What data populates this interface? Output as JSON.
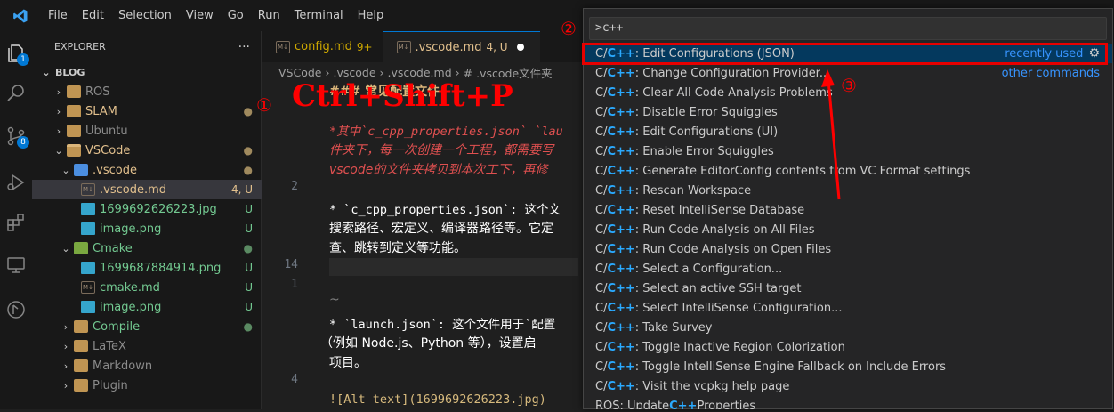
{
  "menu": [
    "File",
    "Edit",
    "Selection",
    "View",
    "Go",
    "Run",
    "Terminal",
    "Help"
  ],
  "activity_badges": {
    "explorer": "1",
    "scm": "8"
  },
  "explorer": {
    "title": "EXPLORER",
    "more": "···",
    "section": "BLOG",
    "items": [
      {
        "label": "ROS",
        "deco": ""
      },
      {
        "label": "SLAM",
        "deco": "●"
      },
      {
        "label": "Ubuntu",
        "deco": ""
      },
      {
        "label": "VSCode",
        "deco": "●"
      },
      {
        "label": ".vscode",
        "deco": "●"
      },
      {
        "label": ".vscode.md",
        "deco": "4, U"
      },
      {
        "label": "1699692626223.jpg",
        "deco": "U"
      },
      {
        "label": "image.png",
        "deco": "U"
      },
      {
        "label": "Cmake",
        "deco": "●"
      },
      {
        "label": "1699687884914.png",
        "deco": "U"
      },
      {
        "label": "cmake.md",
        "deco": "U"
      },
      {
        "label": "image.png",
        "deco": "U"
      },
      {
        "label": "Compile",
        "deco": "●"
      },
      {
        "label": "LaTeX",
        "deco": ""
      },
      {
        "label": "Markdown",
        "deco": ""
      },
      {
        "label": "Plugin",
        "deco": ""
      }
    ]
  },
  "tabs": [
    {
      "label": "config.md",
      "deco": "9+"
    },
    {
      "label": ".vscode.md",
      "deco": "4, U"
    }
  ],
  "breadcrumb": [
    "VSCode",
    ".vscode",
    ".vscode.md",
    "# .vscode文件夹"
  ],
  "editor_lines": [
    {
      "ln": "",
      "text": "### 常见配置文件"
    },
    {
      "ln": "",
      "text": "*其中`c_cpp_properties.json` `lau"
    },
    {
      "ln": "",
      "text": "件夹下，每一次创建一个工程，都需要写"
    },
    {
      "ln": "",
      "text": "vscode的文件夹拷贝到本次工下，再修"
    },
    {
      "ln": "2",
      "text": ""
    },
    {
      "ln": "",
      "text": "* `c_cpp_properties.json`: 这个文"
    },
    {
      "ln": "",
      "text": "搜索路径、宏定义、编译器路径等。它定"
    },
    {
      "ln": "",
      "text": "查、跳转到定义等功能。"
    },
    {
      "ln": "14",
      "text": ""
    },
    {
      "ln": "1",
      "text": ""
    },
    {
      "ln": "",
      "text": "~"
    },
    {
      "ln": "",
      "text": "* `launch.json`: 这个文件用于`配置"
    },
    {
      "ln": "",
      "text": "（例如 Node.js、Python 等），设置启"
    },
    {
      "ln": "",
      "text": "项目。"
    },
    {
      "ln": "4",
      "text": ""
    },
    {
      "ln": "",
      "text": "![Alt text](1699692626223.jpg)"
    }
  ],
  "command_palette": {
    "query": ">c++",
    "commands": [
      {
        "prefix": "C/",
        "hl": "C++",
        "rest": ": Edit Configurations (JSON)",
        "right": "recently used"
      },
      {
        "prefix": "C/",
        "hl": "C++",
        "rest": ": Change Configuration Provider...",
        "right": "other commands"
      },
      {
        "prefix": "C/",
        "hl": "C++",
        "rest": ": Clear All Code Analysis Problems",
        "right": ""
      },
      {
        "prefix": "C/",
        "hl": "C++",
        "rest": ": Disable Error Squiggles",
        "right": ""
      },
      {
        "prefix": "C/",
        "hl": "C++",
        "rest": ": Edit Configurations (UI)",
        "right": ""
      },
      {
        "prefix": "C/",
        "hl": "C++",
        "rest": ": Enable Error Squiggles",
        "right": ""
      },
      {
        "prefix": "C/",
        "hl": "C++",
        "rest": ": Generate EditorConfig contents from VC Format settings",
        "right": ""
      },
      {
        "prefix": "C/",
        "hl": "C++",
        "rest": ": Rescan Workspace",
        "right": ""
      },
      {
        "prefix": "C/",
        "hl": "C++",
        "rest": ": Reset IntelliSense Database",
        "right": ""
      },
      {
        "prefix": "C/",
        "hl": "C++",
        "rest": ": Run Code Analysis on All Files",
        "right": ""
      },
      {
        "prefix": "C/",
        "hl": "C++",
        "rest": ": Run Code Analysis on Open Files",
        "right": ""
      },
      {
        "prefix": "C/",
        "hl": "C++",
        "rest": ": Select a Configuration...",
        "right": ""
      },
      {
        "prefix": "C/",
        "hl": "C++",
        "rest": ": Select an active SSH target",
        "right": ""
      },
      {
        "prefix": "C/",
        "hl": "C++",
        "rest": ": Select IntelliSense Configuration...",
        "right": ""
      },
      {
        "prefix": "C/",
        "hl": "C++",
        "rest": ": Take Survey",
        "right": ""
      },
      {
        "prefix": "C/",
        "hl": "C++",
        "rest": ": Toggle Inactive Region Colorization",
        "right": ""
      },
      {
        "prefix": "C/",
        "hl": "C++",
        "rest": ": Toggle IntelliSense Engine Fallback on Include Errors",
        "right": ""
      },
      {
        "prefix": "C/",
        "hl": "C++",
        "rest": ": Visit the vcpkg help page",
        "right": ""
      },
      {
        "prefix": "ROS: Update ",
        "hl": "C++",
        "rest": " Properties",
        "right": ""
      }
    ]
  },
  "annotations": {
    "step1": "①",
    "shortcut": "Ctrl+Shift+P",
    "step2": "②",
    "step3": "③"
  },
  "colors": {
    "accent": "#0078d4",
    "highlight": "#2aaaff",
    "annotation": "#ff0000",
    "modified": "#e2c08d",
    "untracked": "#73c991"
  }
}
